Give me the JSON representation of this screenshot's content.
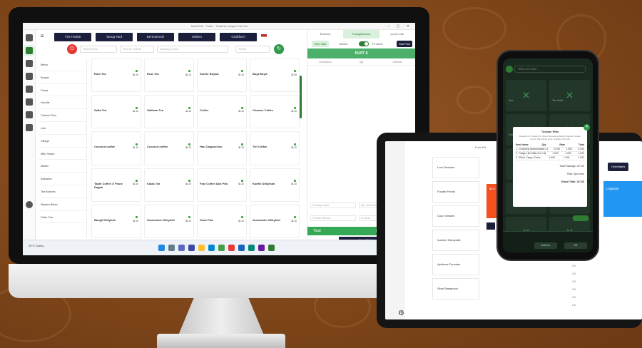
{
  "monitor": {
    "title": "Tarifa Edu · Turtle · Turtamiz Insaptof Yall Ssl",
    "category_tabs": [
      "Ýtre Hedde",
      "Tanug Yard",
      "Bertrosende",
      "Seltem",
      "Graßfurm"
    ],
    "search_fields": [
      "Teblut Turtu",
      "Scel of Turtute",
      "Scanlog Turca",
      "Sorba"
    ],
    "categories": [
      "Menu",
      "Burger",
      "Pasta",
      "Noodle",
      "Clasics Rlon",
      "Lele",
      "Village",
      "Milk Shake",
      "Mattin",
      "Baklama",
      "Tea Monies",
      "Massia Bikes",
      "Sefer Tea"
    ],
    "products": [
      {
        "name": "Rust Tea",
        "price": "$L10"
      },
      {
        "name": "Rust Tea",
        "price": "$L10"
      },
      {
        "name": "Sunter Boyale",
        "price": "$L10"
      },
      {
        "name": "Bugl Boyle",
        "price": "$L05"
      },
      {
        "name": "Salta Tea",
        "price": "$L10"
      },
      {
        "name": "Saffwan Tea",
        "price": "$L10"
      },
      {
        "name": "Coffee",
        "price": "$L10"
      },
      {
        "name": "Chasme Coffee",
        "price": "$L10"
      },
      {
        "name": "Coconut coffee",
        "price": "$L10"
      },
      {
        "name": "Coconut coffee",
        "price": "$L10"
      },
      {
        "name": "Hau Cappuccino",
        "price": "$L10"
      },
      {
        "name": "Tiel Coffee",
        "price": "$L10"
      },
      {
        "name": "Tapte Coffee X Prane Dagah",
        "price": "$L10"
      },
      {
        "name": "Kalak Tea",
        "price": "$L10"
      },
      {
        "name": "Fast Coffee Dan Pita",
        "price": "$L10"
      },
      {
        "name": "Karifle Dilkylhah",
        "price": "$L10"
      },
      {
        "name": "Bangil Dilkyhah",
        "price": "$L10"
      },
      {
        "name": "Gunmaster Dilkyhah",
        "price": "$L10"
      },
      {
        "name": "Sinar Pita",
        "price": "$L10"
      },
      {
        "name": "Gunmaster Dilkyhah",
        "price": "$L10"
      }
    ],
    "order_panel": {
      "tabs": [
        "Brueson",
        "Fuaugbsioana",
        "Quoe Ldar"
      ],
      "left_pill": "Teke Vaat",
      "mid_label": "Biume",
      "toggle_label": "Pl onthe",
      "right_pill": "Mal Plan",
      "header": "RUST $",
      "columns": [
        "Description",
        "Qty",
        "Subtotal"
      ],
      "fields": [
        "Fhosing Faeas",
        "Bpu da Kerate",
        "Fuesive Manhar",
        "At Zinds",
        "Mourkime Rate",
        "Bote Iteraba"
      ],
      "total_label": "Total",
      "total_value": "$",
      "send_button": "Send Kitchen"
    },
    "taskbar": {
      "weather": "29°C Sunny",
      "time": "07:00 PM",
      "date": "23/12/2023"
    }
  },
  "tablet": {
    "title": "Func Ed",
    "items": [
      "Loro Devision",
      "Fouder Feeds",
      "Cour Glmsien",
      "Inactive Devopsite",
      "Aprilmes Foundes",
      "Sinal Sasadosct"
    ],
    "blue_label": "Legional",
    "orange_label": "$3.5",
    "button": "Orientights"
  },
  "phone": {
    "search": "Telbel du Hotle",
    "tiles": [
      "Jex",
      "Tex Nelb",
      "Salta",
      "Coconut Coffee",
      "",
      "",
      "",
      "",
      "",
      ""
    ],
    "receipt": {
      "title": "Tooklae Pitts",
      "address": "Rospilbu la Thulafa Pis. Mustc Rosseleng Batthu Dadhum Mapur Jnmsh. Ban Dinas disnt, Kuslaht 1001 MG",
      "columns": [
        "Item Name",
        "Qty",
        "Rate",
        "Total"
      ],
      "rows": [
        [
          "1. Crowldely Makrushtaah Jo",
          "0.000",
          "1.000",
          "0.000"
        ],
        [
          "2. Fridge Lilln Milta-Go Coll",
          "1.000",
          "1.000",
          "1.000"
        ],
        [
          "3. 3/Huh Cappu Chuls",
          "1.000",
          "1.000",
          "1.000"
        ]
      ],
      "totals": [
        "Total Pasanga:  107.00",
        "Total:  Spot ores",
        "Grand Total:  107.00"
      ]
    },
    "bottom_buttons": [
      "Baldmio",
      "Bill"
    ]
  }
}
